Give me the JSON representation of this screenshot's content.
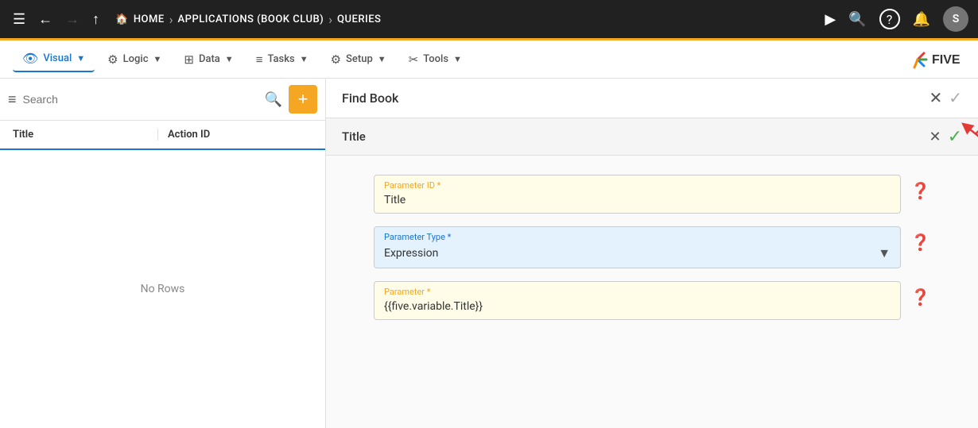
{
  "topNav": {
    "menuIcon": "☰",
    "backIcon": "←",
    "forwardIcon": "→",
    "upIcon": "↑",
    "homeIcon": "⌂",
    "homeLabel": "HOME",
    "sep1": "›",
    "appLabel": "APPLICATIONS (BOOK CLUB)",
    "sep2": "›",
    "currentLabel": "QUERIES",
    "playIcon": "▶",
    "searchIcon": "⊙",
    "helpIcon": "?",
    "bellIcon": "🔔",
    "avatarLabel": "S"
  },
  "secNav": {
    "items": [
      {
        "id": "visual",
        "icon": "👁",
        "label": "Visual",
        "active": true
      },
      {
        "id": "logic",
        "icon": "⚙",
        "label": "Logic",
        "active": false
      },
      {
        "id": "data",
        "icon": "⊞",
        "label": "Data",
        "active": false
      },
      {
        "id": "tasks",
        "icon": "≡",
        "label": "Tasks",
        "active": false
      },
      {
        "id": "setup",
        "icon": "⚙",
        "label": "Setup",
        "active": false
      },
      {
        "id": "tools",
        "icon": "✂",
        "label": "Tools",
        "active": false
      }
    ]
  },
  "sidebar": {
    "searchPlaceholder": "Search",
    "searchValue": "",
    "addButtonLabel": "+",
    "columns": [
      {
        "id": "title",
        "label": "Title"
      },
      {
        "id": "actionId",
        "label": "Action ID"
      }
    ],
    "noRowsText": "No Rows"
  },
  "rightPanel": {
    "headerTitle": "Find Book",
    "closeIcon": "✕",
    "checkIcon": "✓",
    "subPanelTitle": "Title",
    "fields": [
      {
        "id": "parameterId",
        "label": "Parameter ID *",
        "value": "Title",
        "type": "text",
        "bgClass": "yellow"
      },
      {
        "id": "parameterType",
        "label": "Parameter Type *",
        "value": "Expression",
        "type": "select",
        "bgClass": "blue"
      },
      {
        "id": "parameter",
        "label": "Parameter *",
        "value": "{{five.variable.Title}}",
        "type": "text",
        "bgClass": "yellow"
      }
    ]
  }
}
